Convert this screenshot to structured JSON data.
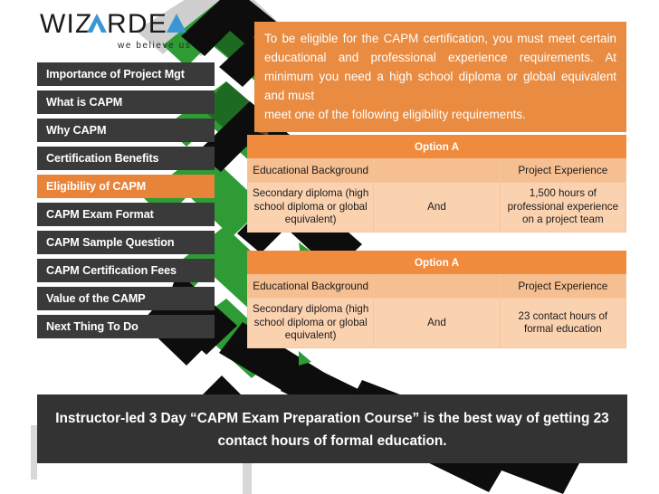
{
  "brand": {
    "name": "WIZARDEA",
    "tagline": "we believe us",
    "accent_color": "#3B97D3",
    "text_color": "#1A1A1A"
  },
  "theme": {
    "orange": "#E8833A",
    "orange_panel": "#E98B40",
    "table_header": "#F08A3C",
    "table_subheader": "#F6BF91",
    "table_body": "#FBD2B0",
    "dark": "#3A3A3A",
    "footer_dark": "#333333"
  },
  "sidebar": {
    "items": [
      {
        "label": "Importance of Project Mgt",
        "active": false
      },
      {
        "label": "What is CAPM",
        "active": false
      },
      {
        "label": "Why CAPM",
        "active": false
      },
      {
        "label": "Certification Benefits",
        "active": false
      },
      {
        "label": "Eligibility of CAPM",
        "active": true
      },
      {
        "label": "CAPM Exam Format",
        "active": false
      },
      {
        "label": "CAPM Sample Question",
        "active": false
      },
      {
        "label": "CAPM Certification Fees",
        "active": false
      },
      {
        "label": "Value of the CAMP",
        "active": false
      },
      {
        "label": "Next Thing To Do",
        "active": false
      }
    ]
  },
  "main": {
    "intro_line1": "To be eligible for the CAPM certification, you must meet certain educational and professional experience requirements. At minimum you need a high school diploma or global equivalent and must",
    "intro_line2": "meet one of the following eligibility requirements.",
    "tables": [
      {
        "title": "Option A",
        "headers": [
          "Educational Background",
          "",
          "Project Experience"
        ],
        "row": [
          "Secondary diploma (high school diploma or global equivalent)",
          "And",
          "1,500 hours of professional experience on a project team"
        ]
      },
      {
        "title": "Option A",
        "headers": [
          "Educational Background",
          "",
          "Project Experience"
        ],
        "row": [
          "Secondary diploma (high school diploma or global equivalent)",
          "And",
          "23 contact hours of formal education"
        ]
      }
    ]
  },
  "footer": {
    "text": "Instructor-led 3 Day “CAPM Exam Preparation Course” is the best way of getting 23 contact hours of formal education."
  }
}
